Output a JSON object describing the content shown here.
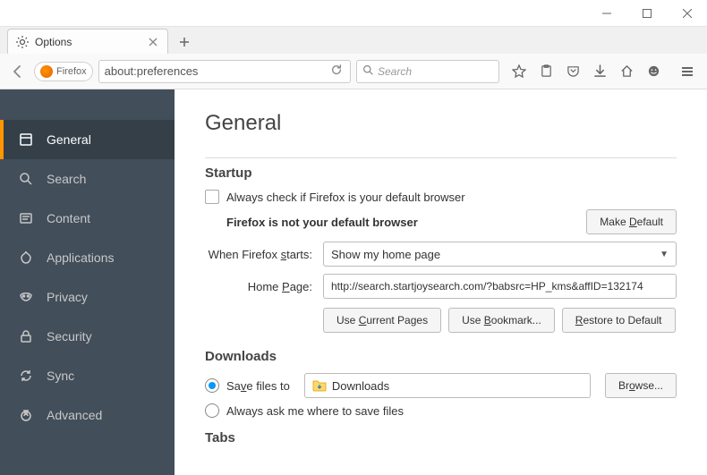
{
  "window": {
    "tab_title": "Options"
  },
  "urlbar": {
    "identity": "Firefox",
    "url": "about:preferences",
    "search_placeholder": "Search"
  },
  "sidebar": {
    "items": [
      {
        "label": "General"
      },
      {
        "label": "Search"
      },
      {
        "label": "Content"
      },
      {
        "label": "Applications"
      },
      {
        "label": "Privacy"
      },
      {
        "label": "Security"
      },
      {
        "label": "Sync"
      },
      {
        "label": "Advanced"
      }
    ]
  },
  "main": {
    "title": "General",
    "startup": {
      "heading": "Startup",
      "default_check_label": "Always check if Firefox is your default browser",
      "default_status": "Firefox is not your default browser",
      "make_default_btn": "Make Default",
      "when_starts_label": "When Firefox starts:",
      "when_starts_value": "Show my home page",
      "home_page_label": "Home Page:",
      "home_page_value": "http://search.startjoysearch.com/?babsrc=HP_kms&affID=132174",
      "use_current_btn": "Use Current Pages",
      "use_bookmark_btn": "Use Bookmark...",
      "restore_default_btn": "Restore to Default"
    },
    "downloads": {
      "heading": "Downloads",
      "save_to_label": "Save files to",
      "path": "Downloads",
      "browse_btn": "Browse...",
      "ask_label": "Always ask me where to save files"
    },
    "tabs": {
      "heading": "Tabs"
    }
  }
}
